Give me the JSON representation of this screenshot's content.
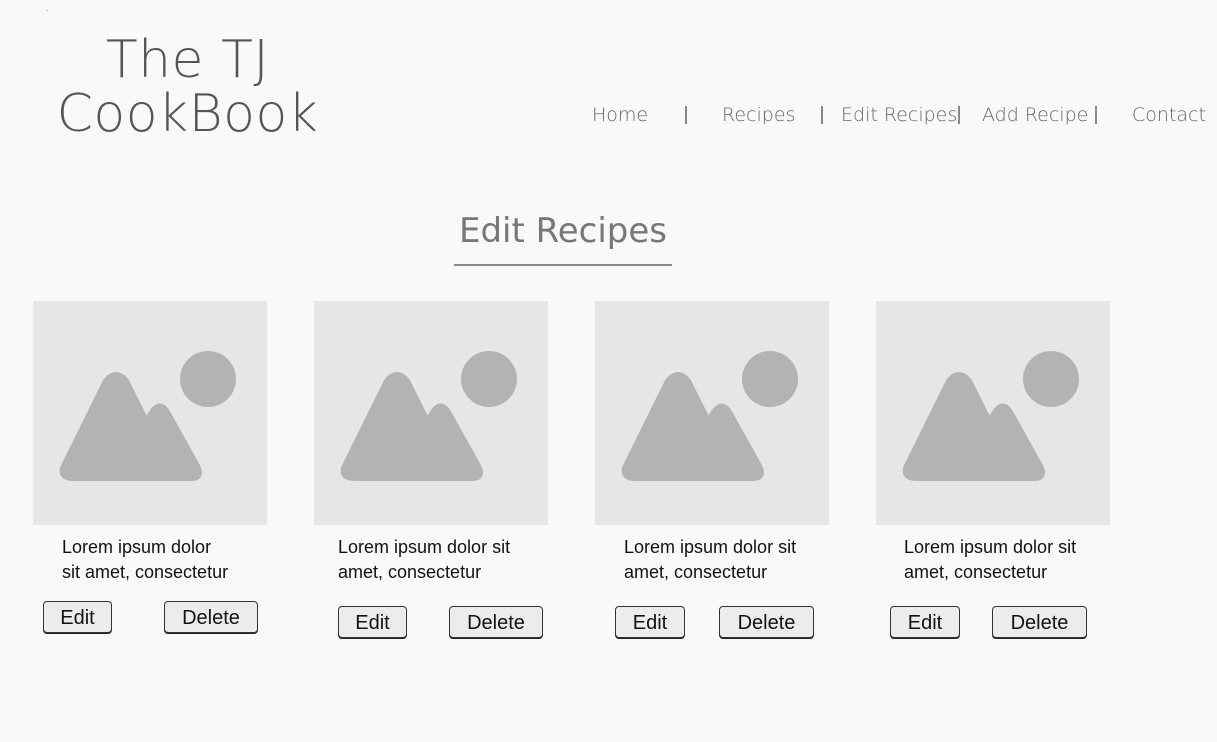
{
  "logo": {
    "line1": "The TJ",
    "line2": "CookBook"
  },
  "nav": {
    "items": [
      {
        "label": "Home"
      },
      {
        "label": "Recipes"
      },
      {
        "label": "Edit Recipes"
      },
      {
        "label": "Add Recipe"
      },
      {
        "label": "Contact"
      }
    ]
  },
  "main": {
    "heading": "Edit Recipes",
    "cards": [
      {
        "line1": "Lorem ipsum dolor",
        "line2": "sit amet, consectetur",
        "edit_label": "Edit",
        "delete_label": "Delete",
        "image_icon": "image-placeholder-icon"
      },
      {
        "line1": "Lorem ipsum dolor sit",
        "line2": "amet, consectetur",
        "edit_label": "Edit",
        "delete_label": "Delete",
        "image_icon": "image-placeholder-icon"
      },
      {
        "line1": "Lorem ipsum dolor sit",
        "line2": "amet, consectetur",
        "edit_label": "Edit",
        "delete_label": "Delete",
        "image_icon": "image-placeholder-icon"
      },
      {
        "line1": "Lorem ipsum dolor sit",
        "line2": "amet, consectetur",
        "edit_label": "Edit",
        "delete_label": "Delete",
        "image_icon": "image-placeholder-icon"
      }
    ]
  },
  "colors": {
    "background": "#f9f9f9",
    "placeholder_bg": "#e6e6e6",
    "placeholder_shape": "#b3b3b3",
    "button_bg": "#ececec"
  }
}
